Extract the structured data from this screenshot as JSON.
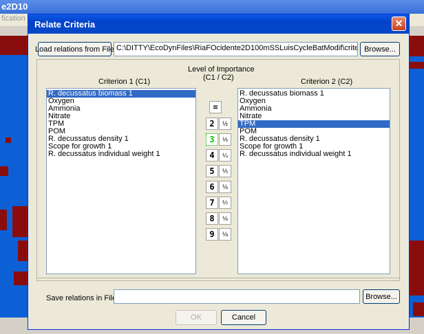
{
  "background": {
    "title_fragment": "e2D10",
    "menu_fragment": "fication"
  },
  "dialog": {
    "title": "Relate Criteria",
    "close_label": "✕",
    "load_button": "Load relations from File",
    "load_path": "C:\\DITTY\\EcoDynFiles\\RiaFOcidente2D100mSSLuisCycleBatModif\\criteria_producti",
    "browse_top": "Browse...",
    "criterion1_header": "Criterion 1 (C1)",
    "importance_header_line1": "Level of Importance",
    "importance_header_line2": "(C1 / C2)",
    "criterion2_header": "Criterion 2 (C2)",
    "criterion1_items": [
      "R. decussatus biomass 1",
      "Oxygen",
      "Ammonia",
      "Nitrate",
      "TPM",
      "POM",
      "R. decussatus density 1",
      "Scope for growth 1",
      "R. decussatus individual weight 1"
    ],
    "criterion1_selected_index": 0,
    "criterion2_items": [
      "R. decussatus biomass 1",
      "Oxygen",
      "Ammonia",
      "Nitrate",
      "TPM",
      "POM",
      "R. decussatus density 1",
      "Scope for growth 1",
      "R. decussatus individual weight 1"
    ],
    "criterion2_selected_index": 4,
    "equal_label": "=",
    "levels": [
      "2",
      "3",
      "4",
      "5",
      "6",
      "7",
      "8",
      "9"
    ],
    "fractions": [
      "½",
      "⅓",
      "¼",
      "⅕",
      "⅙",
      "⅐",
      "⅛",
      "⅑"
    ],
    "active_level": "3",
    "save_label": "Save relations in File",
    "save_path": "",
    "browse_bottom": "Browse...",
    "ok_label": "OK",
    "cancel_label": "Cancel"
  }
}
